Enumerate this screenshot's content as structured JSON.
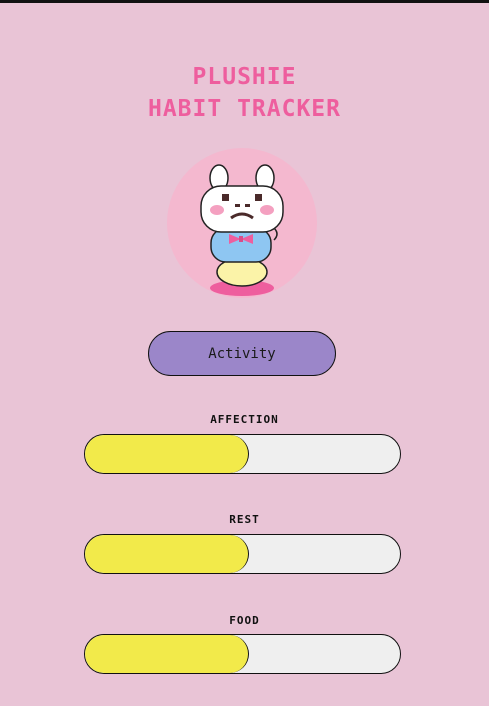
{
  "app": {
    "title_line1": "Plushie",
    "title_line2": "Habit Tracker"
  },
  "avatar": {
    "icon": "bunny-plushie-pixel-art",
    "mood": "sad"
  },
  "activity_button": {
    "label": "Activity"
  },
  "stats": [
    {
      "label": "Affection",
      "level": 0.52
    },
    {
      "label": "Rest",
      "level": 0.52
    },
    {
      "label": "Food",
      "level": 0.52
    }
  ],
  "colors": {
    "background": "#e9c4d6",
    "title": "#ee5e9e",
    "button": "#9b86c9",
    "bar_fill": "#f2ea4a",
    "bar_track": "#efefef"
  }
}
